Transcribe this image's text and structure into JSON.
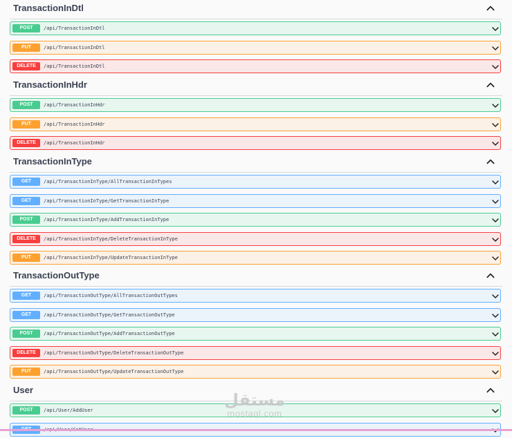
{
  "sections": [
    {
      "title": "TransactionInDtl",
      "operations": [
        {
          "method": "POST",
          "path": "/api/TransactionInDtl"
        },
        {
          "method": "PUT",
          "path": "/api/TransactionInDtl"
        },
        {
          "method": "DELETE",
          "path": "/api/TransactionInDtl"
        }
      ]
    },
    {
      "title": "TransactionInHdr",
      "operations": [
        {
          "method": "POST",
          "path": "/api/TransactionInHdr"
        },
        {
          "method": "PUT",
          "path": "/api/TransactionInHdr"
        },
        {
          "method": "DELETE",
          "path": "/api/TransactionInHdr"
        }
      ]
    },
    {
      "title": "TransactionInType",
      "operations": [
        {
          "method": "GET",
          "path": "/api/TransactionInType/AllTransactionInTypes"
        },
        {
          "method": "GET",
          "path": "/api/TransactionInType/GetTransactionInType"
        },
        {
          "method": "POST",
          "path": "/api/TransactionInType/AddTransactionInType"
        },
        {
          "method": "DELETE",
          "path": "/api/TransactionInType/DeleteTransactionInType"
        },
        {
          "method": "PUT",
          "path": "/api/TransactionInType/UpdateTransactionInType"
        }
      ]
    },
    {
      "title": "TransactionOutType",
      "operations": [
        {
          "method": "GET",
          "path": "/api/TransactionOutType/AllTransactionOutTypes"
        },
        {
          "method": "GET",
          "path": "/api/TransactionOutType/GetTransactionOutType"
        },
        {
          "method": "POST",
          "path": "/api/TransactionOutType/AddTransactionOutType"
        },
        {
          "method": "DELETE",
          "path": "/api/TransactionOutType/DeleteTransactionOutType"
        },
        {
          "method": "PUT",
          "path": "/api/TransactionOutType/UpdateTransactionOutType"
        }
      ]
    },
    {
      "title": "User",
      "operations": [
        {
          "method": "POST",
          "path": "/api/User/AddUser"
        },
        {
          "method": "GET",
          "path": "/api/User/GetUser"
        }
      ]
    }
  ],
  "watermark": {
    "arabic": "مستقل",
    "latin": "mostaql.com"
  },
  "colors": {
    "post": "#49cc90",
    "put": "#fca130",
    "delete": "#f93e3e",
    "get": "#61affe",
    "title": "#3b4151"
  },
  "icons": {
    "section_toggle": "chevron-up-icon",
    "operation_toggle": "chevron-down-icon"
  }
}
